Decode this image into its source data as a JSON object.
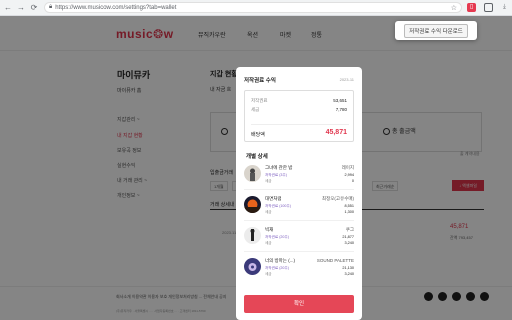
{
  "browser": {
    "back": "←",
    "forward": "→",
    "reload": "⟳",
    "url": "https://www.musicow.com/settings?tab=wallet"
  },
  "header": {
    "logo": "music❂w",
    "nav": [
      "뮤직카우란",
      "옥션",
      "마켓",
      "정통"
    ]
  },
  "sidebar": {
    "title": "마이뮤카",
    "subtitle": "마이뮤카 홈",
    "links": [
      "지갑관리 ~",
      "내 지갑 현황",
      "보유곡 정보",
      "실현수익",
      "내 거래 관리 ~",
      "개인정보 ~"
    ]
  },
  "content": {
    "title": "지갑 현황",
    "subtitle": "내 자금 흐",
    "right_stat": "총 출금액",
    "section_label": "입출금거래",
    "right_note": "출 계약내용",
    "filters": [
      "1개월",
      "3개월",
      "6개월",
      "최근거래순"
    ],
    "excel_btn": "↓ 엑셀파일",
    "table_label": "거래 상세내",
    "row_left": "2023.11",
    "row_value": "45,871",
    "row_value2": "잔액 793,457"
  },
  "footer": {
    "links": "회사소개   이용약관   이용자 보호   개인정보처리방침   ...   전체안내   공지",
    "text": "(주)뮤직카우 · 서울특별시 ... · 사업자등록번호 ... · 고객센터 1811-5760"
  },
  "extension_popup": {
    "button": "저작권료 수익 다운로드"
  },
  "modal": {
    "title": "저작권료 수익",
    "date": "2023-11",
    "summary": {
      "rows": [
        {
          "label": "저작권료",
          "value": "53,651"
        },
        {
          "label": "세금",
          "value": "7,780"
        }
      ],
      "pay_label": "배당액",
      "pay_value": "45,871"
    },
    "detail_title": "개별 상세",
    "items": [
      {
        "title": "그녀에 관한 밤",
        "artist": "레이지",
        "l1": "저작권료 (3주)",
        "l2": "세금",
        "v1": "2,994",
        "v2": "0"
      },
      {
        "title": "대면처럼",
        "artist": "최정오(고유수매)",
        "l1": "저작권료 (100주)",
        "l2": "세금",
        "v1": "8,551",
        "v2": "1,300"
      },
      {
        "title": "빅재",
        "artist": "쿠그",
        "l1": "저작권료 (20주)",
        "l2": "세금",
        "v1": "21,877",
        "v2": "3,240"
      },
      {
        "title": "너의 방마는 (...)",
        "artist": "SOUND PALETTE",
        "l1": "저작권료 (20주)",
        "l2": "세금",
        "v1": "21,130",
        "v2": "3,240"
      }
    ],
    "confirm": "확인"
  },
  "colors": {
    "accent": "#e0354c",
    "confirm": "#e54757",
    "royalty_label": "#7a5bbf"
  }
}
